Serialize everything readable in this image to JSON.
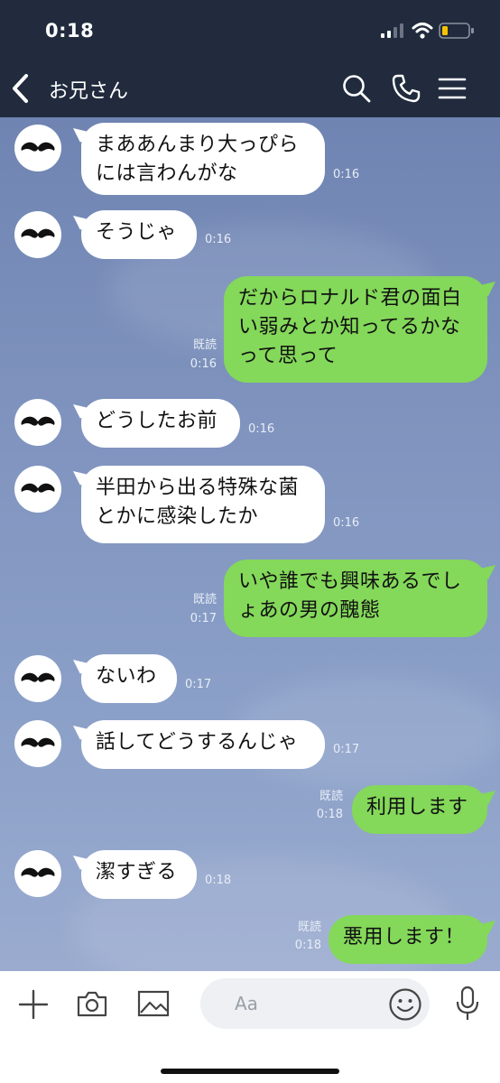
{
  "status_bar": {
    "time": "0:18"
  },
  "header": {
    "title": "お兄さん"
  },
  "messages": [
    {
      "side": "in",
      "text": "まああんまり大っぴら\nには言わんがな",
      "time": "0:16"
    },
    {
      "side": "in",
      "text": "そうじゃ",
      "time": "0:16"
    },
    {
      "side": "out",
      "text": "だからロナルド君の面白\nい弱みとか知ってるかな\nって思って",
      "read": "既読",
      "time": "0:16"
    },
    {
      "side": "in",
      "text": "どうしたお前",
      "time": "0:16"
    },
    {
      "side": "in",
      "text": "半田から出る特殊な菌\nとかに感染したか",
      "time": "0:16"
    },
    {
      "side": "out",
      "text": "いや誰でも興味あるでし\nょあの男の醜態",
      "read": "既読",
      "time": "0:17"
    },
    {
      "side": "in",
      "text": "ないわ",
      "time": "0:17"
    },
    {
      "side": "in",
      "text": "話してどうするんじゃ",
      "time": "0:17"
    },
    {
      "side": "out",
      "text": "利用します",
      "read": "既読",
      "time": "0:18"
    },
    {
      "side": "in",
      "text": "潔すぎる",
      "time": "0:18"
    },
    {
      "side": "out",
      "text": "悪用します！",
      "read": "既読",
      "time": "0:18"
    }
  ],
  "input": {
    "placeholder": "Aa"
  },
  "icons": {
    "back": "chevron-left-icon",
    "search": "search-icon",
    "call": "phone-icon",
    "menu": "menu-icon",
    "add": "plus-icon",
    "camera": "camera-icon",
    "image": "image-icon",
    "emoji": "smiley-icon",
    "mic": "mic-icon"
  },
  "colors": {
    "header": "#212b3d",
    "outgoing_bubble": "#84d85a",
    "incoming_bubble": "#ffffff",
    "chat_bg": "#8094bd"
  }
}
